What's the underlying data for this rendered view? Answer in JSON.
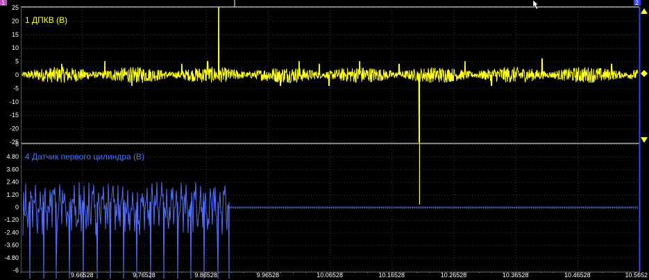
{
  "chart_data": {
    "type": "line",
    "panels": [
      {
        "channel_label": "1 ДПКВ (В)",
        "color": "#ffff22",
        "ylim": [
          -25,
          25
        ],
        "yticks": [
          "25",
          "20",
          "15",
          "10",
          "5",
          "0",
          "-5",
          "-10",
          "-15",
          "-20",
          "-25"
        ],
        "noise_amplitude": 3,
        "spikes": [
          {
            "x": 9.6323,
            "y": 4
          },
          {
            "x": 9.7018,
            "y": 5
          },
          {
            "x": 9.7455,
            "y": -4
          },
          {
            "x": 9.8262,
            "y": 4
          },
          {
            "x": 9.8676,
            "y": 5
          },
          {
            "x": 9.8854,
            "y": 25
          },
          {
            "x": 9.9854,
            "y": -4
          },
          {
            "x": 10.0158,
            "y": 5
          },
          {
            "x": 10.0484,
            "y": 4
          },
          {
            "x": 10.0642,
            "y": -4
          },
          {
            "x": 10.1134,
            "y": 5
          },
          {
            "x": 10.1768,
            "y": 4
          },
          {
            "x": 10.2103,
            "y": -25
          },
          {
            "x": 10.2837,
            "y": 5
          },
          {
            "x": 10.3269,
            "y": -4
          },
          {
            "x": 10.4084,
            "y": 6
          },
          {
            "x": 10.5208,
            "y": 4
          }
        ]
      },
      {
        "channel_label": "4 Датчик первого цилиндра (В)",
        "color": "#4f6dff",
        "ylim": [
          -6,
          6
        ],
        "yticks": [
          "6",
          "4.80",
          "3.60",
          "2.40",
          "1.20",
          "0",
          "-1.20",
          "-2.40",
          "-3.60",
          "-4.80",
          "-6"
        ],
        "active_until_x": 9.9027,
        "deep_pulse_x": [
          9.5804,
          9.6028,
          9.6239,
          9.6453,
          9.667,
          9.6892,
          9.7104,
          9.7322,
          9.7539,
          9.7757,
          9.7977,
          9.8192,
          9.841,
          9.8626,
          9.8842,
          9.9022
        ],
        "deep_pulse_y": -6,
        "peak_y": 2.2
      }
    ],
    "x": {
      "xlim": [
        9.5663,
        10.5652
      ],
      "tick_labels": [
        "9.66528",
        "9.76528",
        "9.86528",
        "9.96528",
        "10.06528",
        "10.16528",
        "10.26528",
        "10.36528",
        "10.46528",
        "10.5652"
      ],
      "tick_values": [
        9.66528,
        9.76528,
        9.86528,
        9.96528,
        10.06528,
        10.16528,
        10.26528,
        10.36528,
        10.46528,
        10.5652
      ]
    },
    "cursor": {
      "x": 10.2103,
      "color": "#ffff22"
    },
    "marker_left": {
      "label": "1",
      "color": "#cc44cc"
    },
    "marker_right": {
      "label": "2",
      "color": "#3344ff"
    },
    "grid": true
  }
}
